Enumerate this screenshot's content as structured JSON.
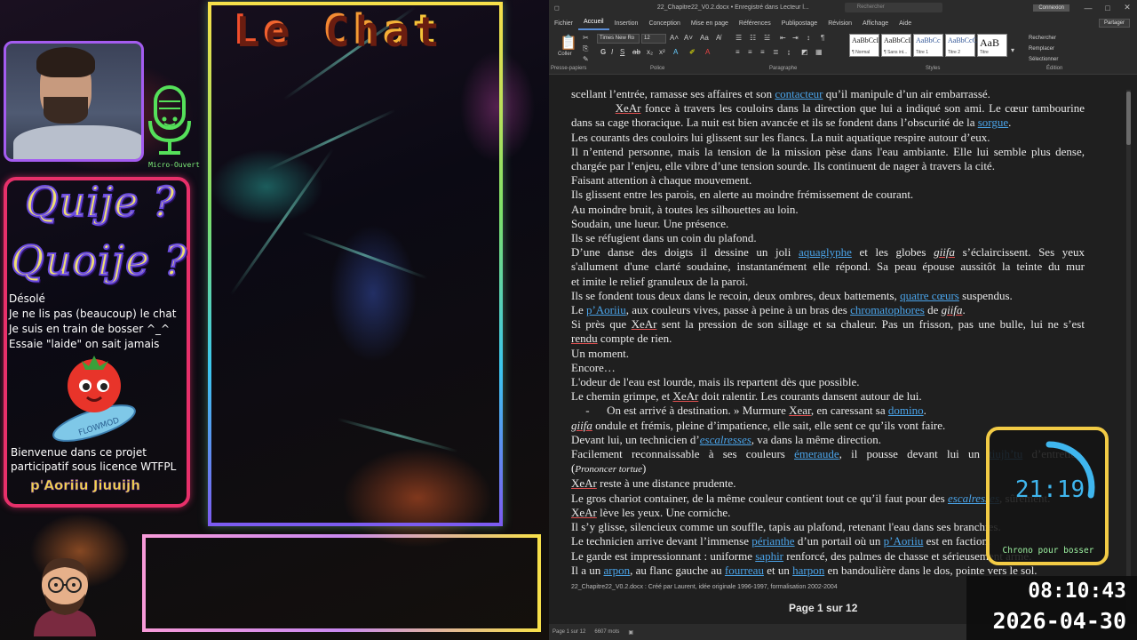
{
  "overlay": {
    "chat_title": "Le Chat",
    "mic_label": "Micro-Ouvert",
    "quiz_line1": "Quije ?",
    "quiz_line2": "Quoije ?",
    "info_lines": [
      "Désolé",
      "Je ne lis pas (beaucoup) le chat",
      "Je suis en train de bosser ^_^",
      "Essaie \"laide\" on sait jamais"
    ],
    "mascot_label": "FLOWMOD",
    "welcome_lines": [
      "Bienvenue dans ce projet",
      "participatif sous licence WTFPL"
    ],
    "signature": "p'Aoriiu Jiuuijh"
  },
  "word": {
    "doc_title": "22_Chapitre22_V0.2.docx • Enregistré dans Lecteur l...",
    "search_placeholder": "Rechercher",
    "connect_label": "Connexion",
    "window_buttons": [
      "—",
      "□",
      "✕"
    ],
    "menu": [
      "Fichier",
      "Accueil",
      "Insertion",
      "Conception",
      "Mise en page",
      "Références",
      "Publipostage",
      "Révision",
      "Affichage",
      "Aide"
    ],
    "share_label": "Partager",
    "ribbon": {
      "paste_label": "Coller",
      "font_name": "Times New Ro",
      "font_size": "12",
      "group_labels": [
        "Presse-papiers",
        "Police",
        "Paragraphe",
        "Styles",
        "Édition"
      ],
      "styles": [
        {
          "sample": "AaBbCcI",
          "name": "¶ Normal"
        },
        {
          "sample": "AaBbCcI",
          "name": "¶ Sans int..."
        },
        {
          "sample": "AaBbCc",
          "name": "Titre 1"
        },
        {
          "sample": "AaBbCcC",
          "name": "Titre 2"
        },
        {
          "sample": "AaB",
          "name": "Titre"
        }
      ],
      "edit_items": [
        "Rechercher",
        "Remplacer",
        "Sélectionner"
      ]
    },
    "footer_text": "22_Chapitre22_V0.2.docx : Créé par Laurent, idée originale 1996-1997, formalisation 2002-2004",
    "page_label": "Page 1 sur 12",
    "status": [
      "Page 1 sur 12",
      "6607 mots"
    ]
  },
  "chrono": {
    "time": "21:19",
    "label": "Chrono pour bosser",
    "progress": 0.28
  },
  "clock": {
    "time": "08:10:43",
    "date": "2026-04-30"
  },
  "colors": {
    "link": "#4aa3e8",
    "chrono_border": "#f2cb45",
    "chrono_digits": "#3fb6ee"
  }
}
